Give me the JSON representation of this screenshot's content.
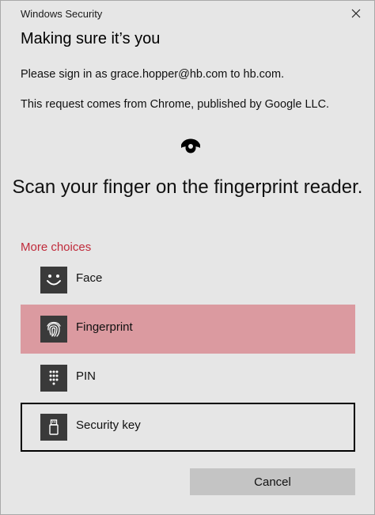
{
  "window": {
    "app_title": "Windows Security",
    "close_icon": "close-icon"
  },
  "content": {
    "heading": "Making sure it’s you",
    "sign_in_message": "Please sign in as grace.hopper@hb.com to hb.com.",
    "request_message": "This request comes from Chrome, published by Google LLC.",
    "sensor_icon": "fingerprint-sensor-icon",
    "instruction": "Scan your finger on the fingerprint reader."
  },
  "more_choices": {
    "label": "More choices",
    "selected": "Fingerprint",
    "focused": "Security key",
    "options": [
      {
        "label": "Face",
        "icon": "face-icon"
      },
      {
        "label": "Fingerprint",
        "icon": "fingerprint-icon"
      },
      {
        "label": "PIN",
        "icon": "pin-keypad-icon"
      },
      {
        "label": "Security key",
        "icon": "security-key-icon"
      }
    ]
  },
  "footer": {
    "cancel_label": "Cancel"
  },
  "colors": {
    "dialog_background": "#e6e6e6",
    "link_accent": "#c02b3b",
    "selected_option_background": "#db9aa0",
    "icon_tile": "#3a3a3a",
    "cancel_button": "#c4c4c4"
  }
}
